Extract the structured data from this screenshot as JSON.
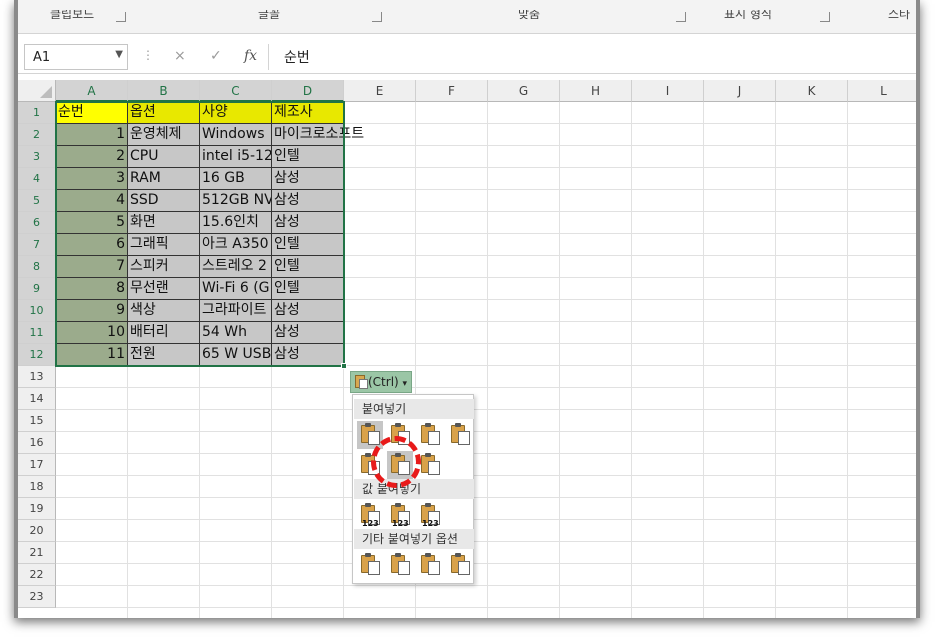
{
  "ribbon": {
    "groups": [
      "클립보드",
      "글꼴",
      "맞춤",
      "표시 형식",
      "스타"
    ]
  },
  "formula_bar": {
    "name_box": "A1",
    "cancel_icon": "×",
    "enter_icon": "✓",
    "fx_icon": "fx",
    "formula": "순번"
  },
  "columns": [
    "A",
    "B",
    "C",
    "D",
    "E",
    "F",
    "G",
    "H",
    "I",
    "J",
    "K",
    "L"
  ],
  "rows": [
    "1",
    "2",
    "3",
    "4",
    "5",
    "6",
    "7",
    "8",
    "9",
    "10",
    "11",
    "12",
    "13",
    "14",
    "15",
    "16",
    "17",
    "18",
    "19",
    "20",
    "21",
    "22",
    "23"
  ],
  "table": {
    "header": [
      "순번",
      "옵션",
      "사양",
      "제조사"
    ],
    "rows": [
      [
        "1",
        "운영체제",
        "Windows",
        "마이크로소프트"
      ],
      [
        "2",
        "CPU",
        "intel i5-12",
        "인텔"
      ],
      [
        "3",
        "RAM",
        "16 GB",
        "삼성"
      ],
      [
        "4",
        "SSD",
        "512GB NV",
        "삼성"
      ],
      [
        "5",
        "화면",
        "15.6인치 ",
        "삼성"
      ],
      [
        "6",
        "그래픽",
        "아크 A350",
        "인텔"
      ],
      [
        "7",
        "스피커",
        "스트레오 2",
        "인텔"
      ],
      [
        "8",
        "무선랜",
        "Wi-Fi 6 (G",
        "인텔"
      ],
      [
        "9",
        "색상",
        "그라파이트",
        "삼성"
      ],
      [
        "10",
        "배터리",
        "54 Wh",
        "삼성"
      ],
      [
        "11",
        "전원",
        "65 W USB",
        "삼성"
      ]
    ]
  },
  "paste_options": {
    "button_label": "(Ctrl)",
    "dropdown_icon": "▾",
    "section_paste": "붙여넣기",
    "section_values": "값 붙여넣기",
    "section_other": "기타 붙여넣기 옵션",
    "paste_buttons": [
      "paste-icon",
      "paste-formulas-icon",
      "paste-formulas-number-format-icon",
      "keep-source-formatting-icon",
      "no-borders-icon",
      "keep-column-widths-icon",
      "transpose-icon"
    ],
    "value_buttons": [
      {
        "icon": "paste-values-icon",
        "tag": "123"
      },
      {
        "icon": "values-number-format-icon",
        "tag": "123"
      },
      {
        "icon": "values-source-formatting-icon",
        "tag": "123"
      }
    ],
    "other_buttons": [
      "formatting-icon",
      "paste-link-icon",
      "picture-icon",
      "linked-picture-icon"
    ]
  },
  "colors": {
    "selection": "#217346",
    "header_fill": "#ffff00",
    "number_fill": "#9bab8c",
    "body_fill": "#c7c7c7",
    "highlight": "#e81a1a"
  }
}
